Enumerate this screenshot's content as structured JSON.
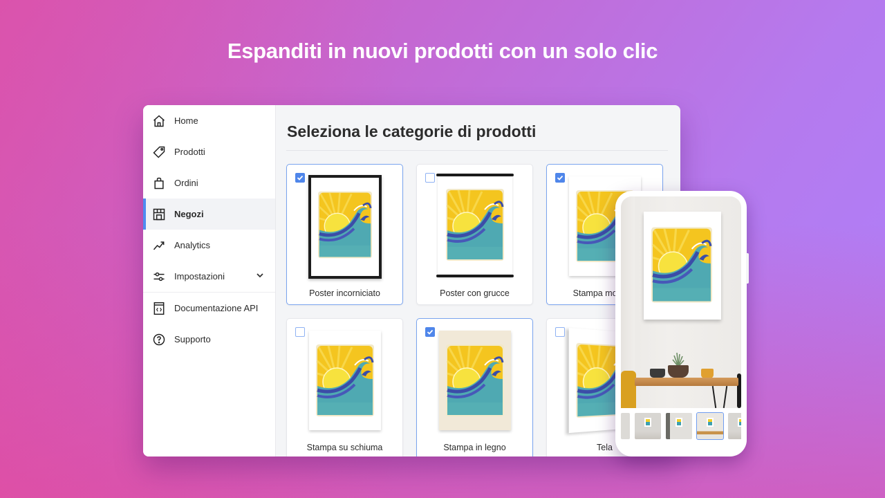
{
  "headline": "Espanditi in nuovi prodotti con un solo clic",
  "colors": {
    "accent": "#4f86ea",
    "bg_top_left": "#d55ab8",
    "bg_top_right": "#ad80fb",
    "bg_bottom_left": "#e44a93",
    "bg_bottom_right": "#b275f5"
  },
  "sidebar": {
    "items": [
      {
        "label": "Home",
        "icon": "home-icon",
        "active": false
      },
      {
        "label": "Prodotti",
        "icon": "tag-icon",
        "active": false
      },
      {
        "label": "Ordini",
        "icon": "shopping-bag-icon",
        "active": false
      },
      {
        "label": "Negozi",
        "icon": "storefront-icon",
        "active": true
      },
      {
        "label": "Analytics",
        "icon": "trending-up-icon",
        "active": false
      },
      {
        "label": "Impostazioni",
        "icon": "sliders-icon",
        "active": false,
        "has_submenu": true
      },
      {
        "label": "Documentazione API",
        "icon": "code-document-icon",
        "active": false
      },
      {
        "label": "Supporto",
        "icon": "help-circle-icon",
        "active": false
      }
    ]
  },
  "main": {
    "title": "Seleziona le categorie di prodotti",
    "products": [
      {
        "label": "Poster incorniciato",
        "checked": true
      },
      {
        "label": "Poster con grucce",
        "checked": false
      },
      {
        "label": "Stampa montata",
        "checked": true
      },
      {
        "label": "Stampa su schiuma",
        "checked": false
      },
      {
        "label": "Stampa in legno",
        "checked": true
      },
      {
        "label": "Tela",
        "checked": false
      }
    ]
  },
  "phone_preview": {
    "thumbnails_count": 5,
    "active_thumbnail": 4
  }
}
